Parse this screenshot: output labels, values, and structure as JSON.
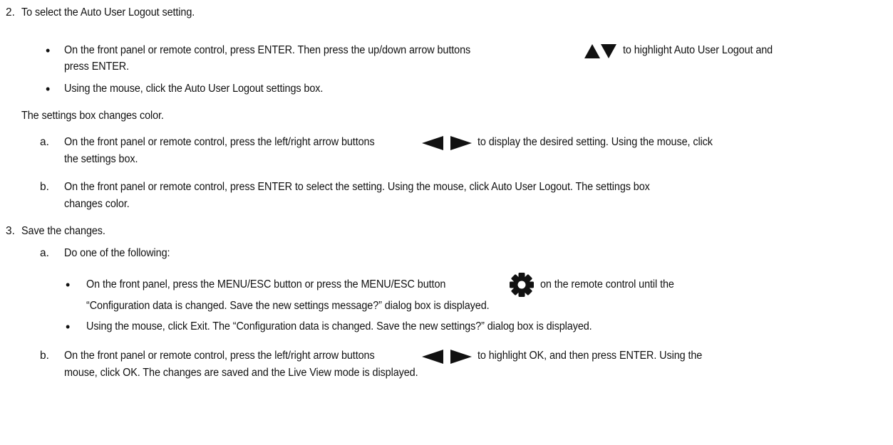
{
  "step2": {
    "number": "2.",
    "text": "To select the Auto User Logout setting.",
    "bullet1": {
      "line1_before": "On the front panel or remote control, press ENTER. Then press the up/down arrow buttons",
      "line1_after": "to highlight Auto User Logout and",
      "line2": "press ENTER."
    },
    "bullet2": "Using the mouse, click the Auto User Logout settings box.",
    "note": "The settings box changes color.",
    "sub_a": {
      "letter": "a.",
      "line1_before": "On the front panel or remote control, press the left/right arrow buttons",
      "line1_after": "to display the desired setting. Using the mouse, click",
      "line2": "the settings box."
    },
    "sub_b": {
      "letter": "b.",
      "line1": "On the front panel or remote control, press ENTER to select the setting. Using the mouse, click Auto User Logout. The settings box",
      "line2": "changes color."
    }
  },
  "step3": {
    "number": "3.",
    "text": "Save the changes.",
    "sub_a": {
      "letter": "a.",
      "text": "Do one of the following:",
      "bullet1": {
        "line1_before": "On the front panel, press the MENU/ESC button or press the MENU/ESC button",
        "line1_after": "on the remote control until the",
        "line2": "“Configuration data is changed. Save the new settings message?” dialog box is displayed."
      },
      "bullet2": "Using the mouse, click Exit. The “Configuration data is changed. Save the new settings?” dialog box is displayed."
    },
    "sub_b": {
      "letter": "b.",
      "line1_before": "On the front panel or remote control, press the left/right arrow buttons",
      "line1_after": "to highlight OK, and then press ENTER. Using the",
      "line2": "mouse, click OK. The changes are saved and the Live View mode is displayed."
    }
  },
  "bullet_char": "•",
  "icons": [
    "up-arrow-icon",
    "down-arrow-icon",
    "left-arrow-icon",
    "right-arrow-icon",
    "gear-icon"
  ],
  "colors": {
    "text": "#111111",
    "icon": "#111111",
    "background": "#ffffff"
  }
}
